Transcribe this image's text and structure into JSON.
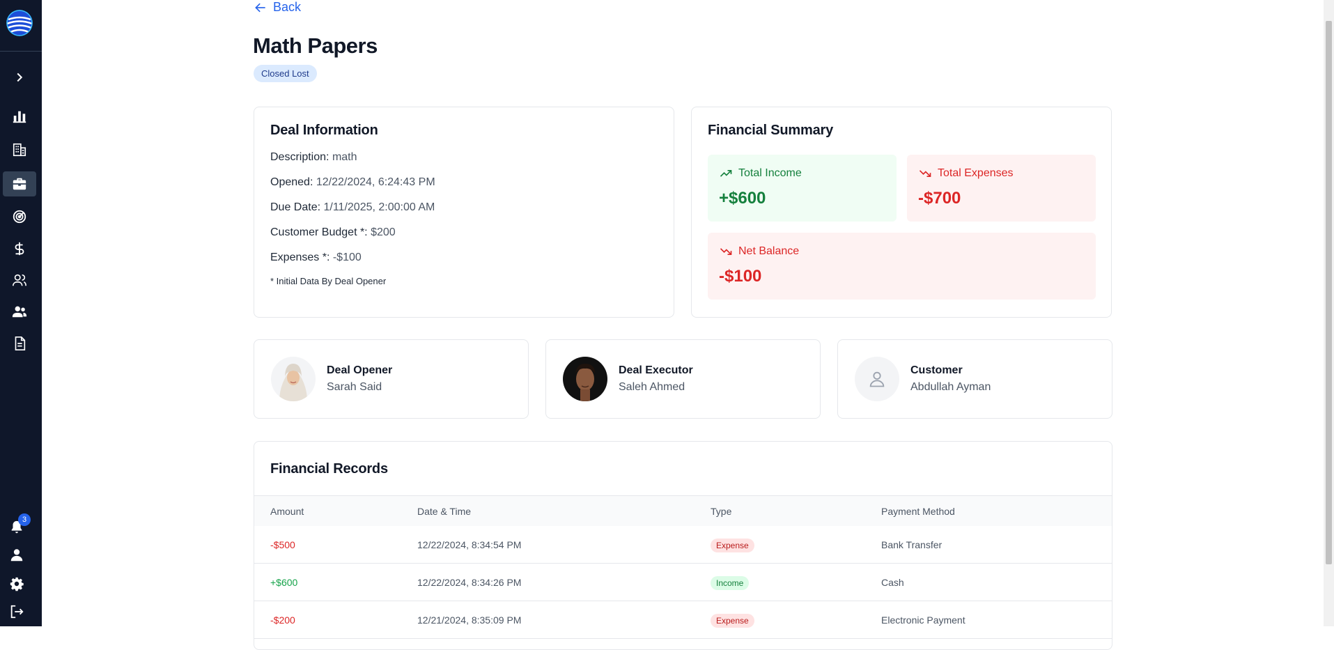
{
  "sidebar": {
    "items": [
      {
        "name": "expand-sidebar",
        "icon": "chevron-right-icon"
      },
      {
        "name": "dashboard",
        "icon": "bar-chart-icon"
      },
      {
        "name": "companies",
        "icon": "building-icon"
      },
      {
        "name": "deals",
        "icon": "briefcase-icon",
        "active": true
      },
      {
        "name": "targets",
        "icon": "target-icon"
      },
      {
        "name": "finance",
        "icon": "dollar-icon"
      },
      {
        "name": "users",
        "icon": "users-icon"
      },
      {
        "name": "team",
        "icon": "team-icon"
      },
      {
        "name": "documents",
        "icon": "document-icon"
      }
    ],
    "notifications_count": "3"
  },
  "header": {
    "back_label": "Back",
    "title": "Math Papers",
    "status": "Closed Lost"
  },
  "deal_info": {
    "title": "Deal Information",
    "rows": [
      {
        "label": "Description:",
        "value": "math"
      },
      {
        "label": "Opened:",
        "value": "12/22/2024, 6:24:43 PM"
      },
      {
        "label": "Due Date:",
        "value": "1/11/2025, 2:00:00 AM"
      },
      {
        "label": "Customer Budget *:",
        "value": "$200"
      },
      {
        "label": "Expenses *:",
        "value": "-$100"
      }
    ],
    "note": "* Initial Data By Deal Opener"
  },
  "financial_summary": {
    "title": "Financial Summary",
    "total_income_label": "Total Income",
    "total_income_value": "+$600",
    "total_expenses_label": "Total Expenses",
    "total_expenses_value": "-$700",
    "net_balance_label": "Net Balance",
    "net_balance_value": "-$100"
  },
  "people": {
    "opener_role": "Deal Opener",
    "opener_name": "Sarah Said",
    "executor_role": "Deal Executor",
    "executor_name": "Saleh Ahmed",
    "customer_role": "Customer",
    "customer_name": "Abdullah Ayman"
  },
  "records": {
    "title": "Financial Records",
    "columns": [
      "Amount",
      "Date & Time",
      "Type",
      "Payment Method"
    ],
    "rows": [
      {
        "amount": "-$500",
        "date": "12/22/2024, 8:34:54 PM",
        "type": "Expense",
        "method": "Bank Transfer"
      },
      {
        "amount": "+$600",
        "date": "12/22/2024, 8:34:26 PM",
        "type": "Income",
        "method": "Cash"
      },
      {
        "amount": "-$200",
        "date": "12/21/2024, 8:35:09 PM",
        "type": "Expense",
        "method": "Electronic Payment"
      }
    ]
  },
  "colors": {
    "sidebar_bg": "#0f172a",
    "accent": "#2563eb",
    "positive": "#16a34a",
    "negative": "#dc2626"
  }
}
